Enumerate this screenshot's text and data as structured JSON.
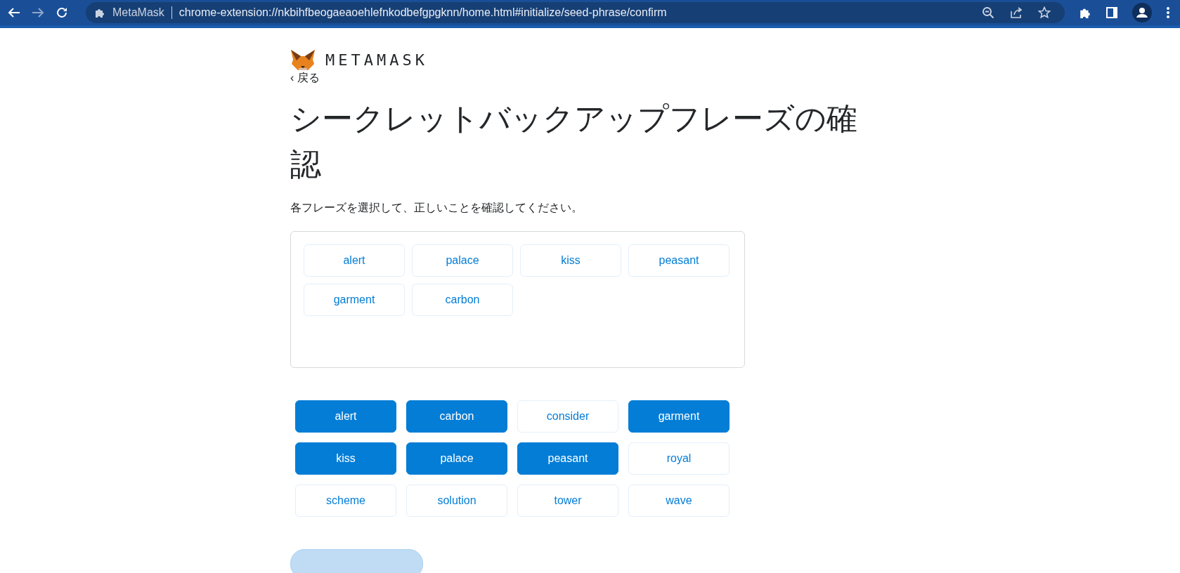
{
  "browser": {
    "site_name": "MetaMask",
    "url": "chrome-extension://nkbihfbeogaeaoehlefnkodbefgpgknn/home.html#initialize/seed-phrase/confirm"
  },
  "logo": {
    "wordmark": "METAMASK"
  },
  "back_link": "‹ 戻る",
  "title": "シークレットバックアップフレーズの確認",
  "instruction": "各フレーズを選択して、正しいことを確認してください。",
  "selected_words": [
    "alert",
    "palace",
    "kiss",
    "peasant",
    "garment",
    "carbon"
  ],
  "word_bank": [
    {
      "word": "alert",
      "selected": true
    },
    {
      "word": "carbon",
      "selected": true
    },
    {
      "word": "consider",
      "selected": false
    },
    {
      "word": "garment",
      "selected": true
    },
    {
      "word": "kiss",
      "selected": true
    },
    {
      "word": "palace",
      "selected": true
    },
    {
      "word": "peasant",
      "selected": true
    },
    {
      "word": "royal",
      "selected": false
    },
    {
      "word": "scheme",
      "selected": false
    },
    {
      "word": "solution",
      "selected": false
    },
    {
      "word": "tower",
      "selected": false
    },
    {
      "word": "wave",
      "selected": false
    }
  ]
}
